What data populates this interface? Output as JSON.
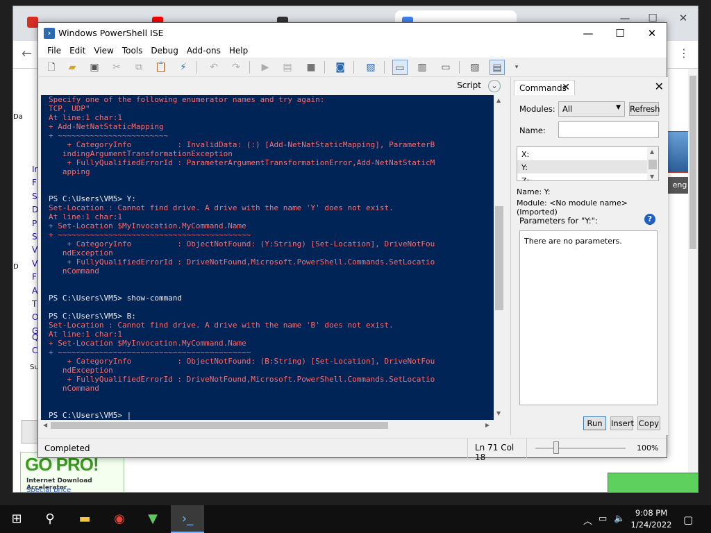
{
  "browser": {
    "tabs": [
      {
        "label": "…"
      },
      {
        "label": "…"
      },
      {
        "label": "…"
      },
      {
        "label": "…"
      }
    ],
    "side_letters": [
      "In",
      "F",
      "S",
      "D",
      "P",
      "S",
      "V",
      "V",
      "F",
      "A",
      "T",
      "O",
      "G"
    ],
    "side_letters2": [
      "Q",
      "C"
    ],
    "left_labels": {
      "da": "Da",
      "d": "D",
      "su": "Su"
    },
    "banner": {
      "headline": "GO PRO!",
      "sub": "Internet Download Accelerator",
      "special": "Special price"
    },
    "right_badge": "eng"
  },
  "ise": {
    "title": "Windows PowerShell ISE",
    "menu": [
      "File",
      "Edit",
      "View",
      "Tools",
      "Debug",
      "Add-ons",
      "Help"
    ],
    "script_label": "Script",
    "console_lines": [
      {
        "t": "Specify one of the following enumerator names and try again:",
        "c": "err"
      },
      {
        "t": "TCP, UDP\"",
        "c": "err"
      },
      {
        "t": "At line:1 char:1",
        "c": "err"
      },
      {
        "t": "+ Add-NetNatStaticMapping",
        "c": "err"
      },
      {
        "t": "+ ~~~~~~~~~~~~~~~~~~~~~~~~",
        "c": "err"
      },
      {
        "t": "    + CategoryInfo          : InvalidData: (:) [Add-NetNatStaticMapping], ParameterB",
        "c": "err"
      },
      {
        "t": "   indingArgumentTransformationException",
        "c": "err"
      },
      {
        "t": "    + FullyQualifiedErrorId : ParameterArgumentTransformationError,Add-NetNatStaticM",
        "c": "err"
      },
      {
        "t": "   apping",
        "c": "err"
      },
      {
        "t": "",
        "c": "ok"
      },
      {
        "t": "",
        "c": "ok"
      },
      {
        "t": "PS C:\\Users\\VM5> Y:",
        "c": "ok"
      },
      {
        "t": "Set-Location : Cannot find drive. A drive with the name 'Y' does not exist.",
        "c": "err"
      },
      {
        "t": "At line:1 char:1",
        "c": "err"
      },
      {
        "t": "+ Set-Location $MyInvocation.MyCommand.Name",
        "c": "err"
      },
      {
        "t": "+ ~~~~~~~~~~~~~~~~~~~~~~~~~~~~~~~~~~~~~~~~~~",
        "c": "err"
      },
      {
        "t": "    + CategoryInfo          : ObjectNotFound: (Y:String) [Set-Location], DriveNotFou",
        "c": "err"
      },
      {
        "t": "   ndException",
        "c": "err"
      },
      {
        "t": "    + FullyQualifiedErrorId : DriveNotFound,Microsoft.PowerShell.Commands.SetLocatio",
        "c": "err"
      },
      {
        "t": "   nCommand",
        "c": "err"
      },
      {
        "t": "",
        "c": "ok"
      },
      {
        "t": "",
        "c": "ok"
      },
      {
        "t": "PS C:\\Users\\VM5> show-command",
        "c": "ok"
      },
      {
        "t": "",
        "c": "ok"
      },
      {
        "t": "PS C:\\Users\\VM5> B:",
        "c": "ok"
      },
      {
        "t": "Set-Location : Cannot find drive. A drive with the name 'B' does not exist.",
        "c": "err"
      },
      {
        "t": "At line:1 char:1",
        "c": "err"
      },
      {
        "t": "+ Set-Location $MyInvocation.MyCommand.Name",
        "c": "err"
      },
      {
        "t": "+ ~~~~~~~~~~~~~~~~~~~~~~~~~~~~~~~~~~~~~~~~~~",
        "c": "err"
      },
      {
        "t": "    + CategoryInfo          : ObjectNotFound: (B:String) [Set-Location], DriveNotFou",
        "c": "err"
      },
      {
        "t": "   ndException",
        "c": "err"
      },
      {
        "t": "    + FullyQualifiedErrorId : DriveNotFound,Microsoft.PowerShell.Commands.SetLocatio",
        "c": "err"
      },
      {
        "t": "   nCommand",
        "c": "err"
      },
      {
        "t": "",
        "c": "ok"
      },
      {
        "t": "",
        "c": "ok"
      },
      {
        "t": "PS C:\\Users\\VM5> |",
        "c": "ok"
      }
    ],
    "status": {
      "text": "Completed",
      "position": "Ln 71  Col 18",
      "zoom": "100%"
    }
  },
  "commands": {
    "tab_label": "Commands",
    "modules_label": "Modules:",
    "modules_value": "All",
    "refresh_label": "Refresh",
    "name_label": "Name:",
    "name_value": "",
    "list": [
      "X:",
      "Y:",
      "Z:"
    ],
    "selected": "Y:",
    "info_name": "Name: Y:",
    "info_module": "Module: <No module name> (Imported)",
    "params_header": "Parameters for \"Y:\":",
    "no_params": "There are no parameters.",
    "run_label": "Run",
    "insert_label": "Insert",
    "copy_label": "Copy"
  },
  "taskbar": {
    "time": "9:08 PM",
    "date": "1/24/2022"
  },
  "colors": {
    "console_bg": "#012456",
    "console_error": "#ff6b6b",
    "console_text": "#eeedf0"
  }
}
